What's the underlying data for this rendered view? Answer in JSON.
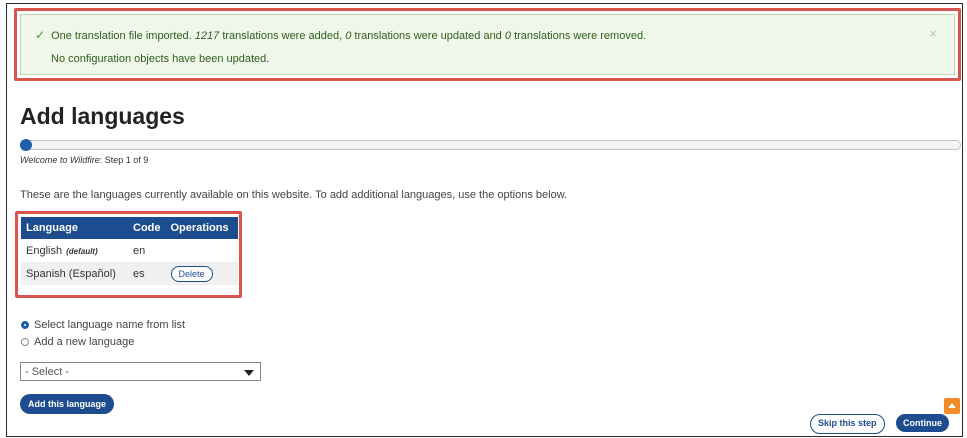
{
  "message": {
    "line1_prefix": "One translation file imported.",
    "imported_count": "1217",
    "added_suffix": "translations were added,",
    "updated_count": "0",
    "updated_suffix": "translations were updated and",
    "removed_count": "0",
    "removed_suffix": "translations were removed.",
    "line2": "No configuration objects have been updated.",
    "close_glyph": "×"
  },
  "page": {
    "title": "Add languages",
    "step_site": "Welcome to Wildfire",
    "step_text": ": Step 1 of 9",
    "progress_fraction": 0.0,
    "intro": "These are the languages currently available on this website. To add additional languages, use the options below."
  },
  "languages_table": {
    "headers": [
      "Language",
      "Code",
      "Operations"
    ],
    "rows": [
      {
        "language": "English",
        "tag": "(default)",
        "code": "en",
        "operation": ""
      },
      {
        "language": "Spanish (Español)",
        "tag": "",
        "code": "es",
        "operation": "Delete"
      }
    ]
  },
  "form": {
    "radio_select": "Select language name from list",
    "radio_add": "Add a new language",
    "selected_option": "select_from_list",
    "select_value": "- Select -",
    "add_button": "Add this language"
  },
  "footer": {
    "skip_button": "Skip this step",
    "continue_button": "Continue"
  },
  "colors": {
    "primary": "#1d4d8f",
    "success_bg": "#eef7ea",
    "highlight": "#d9534f",
    "scroll_top": "#f28c28"
  }
}
